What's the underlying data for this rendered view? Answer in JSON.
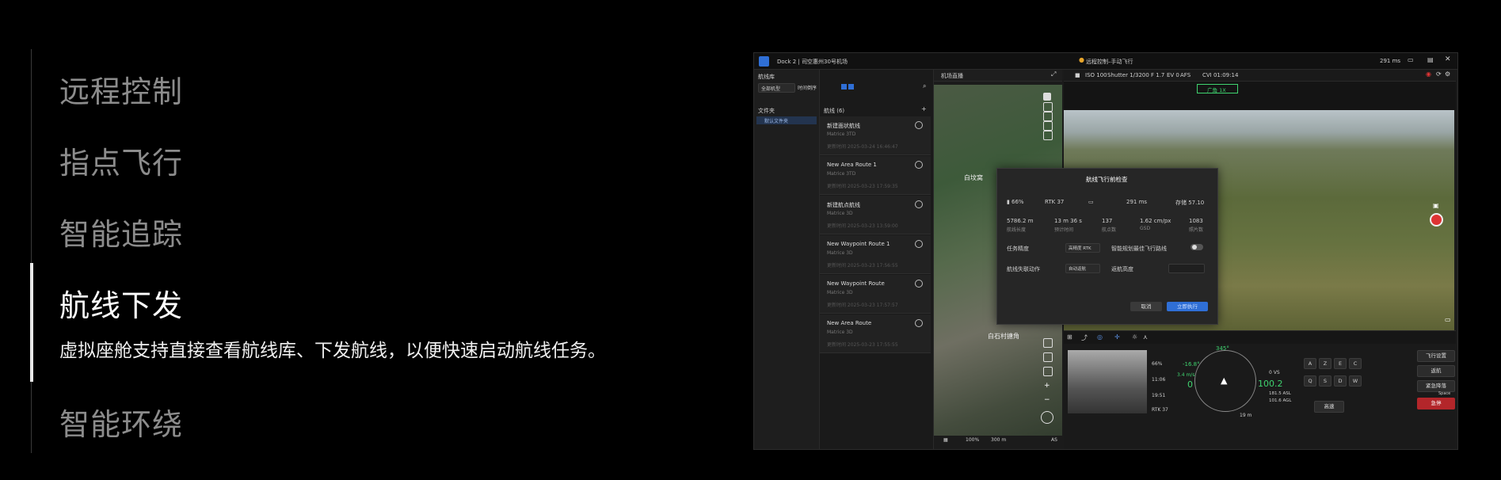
{
  "features": [
    {
      "label": "远程控制"
    },
    {
      "label": "指点飞行"
    },
    {
      "label": "智能追踪"
    },
    {
      "label": "航线下发",
      "active": true
    },
    {
      "label": "智能环绕"
    }
  ],
  "feature_desc": "虚拟座舱支持直接查看航线库、下发航线，以便快速启动航线任务。",
  "app": {
    "title": "Dock 2 | 司空惠州30号机场",
    "status": "远程控制–手动飞行",
    "latency": "291 ms"
  },
  "library": {
    "header": "航线库",
    "filter_model": "全部机型",
    "filter_sort": "时间倒序",
    "folders_header": "文件夹",
    "folder_default": "默认文件夹",
    "routes_header": "航线 (6)",
    "routes": [
      {
        "name": "新建面状航线",
        "model": "Matrice 3TD",
        "date": "更新时间 2025-03-24 16:46:47"
      },
      {
        "name": "New Area Route 1",
        "model": "Matrice 3TD",
        "date": "更新时间 2025-03-23 17:59:35"
      },
      {
        "name": "新建航点航线",
        "model": "Matrice 3D",
        "date": "更新时间 2025-03-23 13:59:00"
      },
      {
        "name": "New Waypoint Route 1",
        "model": "Matrice 3D",
        "date": "更新时间 2025-03-23 17:56:55"
      },
      {
        "name": "New Waypoint Route",
        "model": "Matrice 3D",
        "date": "更新时间 2025-03-23 17:57:57"
      },
      {
        "name": "New Area Route",
        "model": "Matrice 3D",
        "date": "更新时间 2025-03-23 17:55:55"
      }
    ]
  },
  "map": {
    "header": "机场直播",
    "label1": "白坟窝",
    "label2": "白石村搪角",
    "zoom": "100%",
    "scale": "300 m",
    "corner": "AS"
  },
  "camera": {
    "iso": "ISO 100",
    "shutter": "Shutter 1/3200",
    "fnum": "F 1.7",
    "ev": "EV 0",
    "af": "AFS",
    "rec": "CVI 01:09:14",
    "mode": "广角 1X"
  },
  "dialog": {
    "title": "航线飞行前检查",
    "battery": "66%",
    "rtk": "RTK 37",
    "latency": "291 ms",
    "storage": "存储 57.10",
    "stats": [
      {
        "value": "5786.2 m",
        "label": "航线长度"
      },
      {
        "value": "13 m 36 s",
        "label": "预计时间"
      },
      {
        "value": "137",
        "label": "航点数"
      },
      {
        "value": "1.62 cm/px",
        "label": "GSD"
      },
      {
        "value": "1083",
        "label": "照片数"
      }
    ],
    "precision_label": "任务精度",
    "precision_value": "高精度 RTK",
    "optimal_label": "智能规划最佳飞行路线",
    "lost_label": "航线失联动作",
    "lost_value": "自动返航",
    "rth_label": "返航高度",
    "cancel": "取消",
    "confirm": "立即执行"
  },
  "telemetry": {
    "battery": "66%",
    "time1": "11:06",
    "time2": "19:51",
    "rtk": "RTK 37",
    "heading": "345°",
    "pitch": "-16.8°",
    "hspeed": "3.4 m/s",
    "spd": "0",
    "vs": "0 VS",
    "alt": "100.2",
    "asl": "181.5 ASL",
    "agl": "101.6 AGL",
    "dist": "19 m"
  },
  "keys": [
    "A",
    "Z",
    "E",
    "C",
    "Q",
    "S",
    "D",
    "W"
  ],
  "key_low": "高速",
  "actions": {
    "flight_settings": "飞行设置",
    "rth": "返航",
    "emergency": "紧急降落",
    "pause": "急停",
    "pause_key": "Space"
  },
  "colors": {
    "accent": "#2f6fd6",
    "danger": "#b3262a",
    "active_text": "#ffffff",
    "inactive_text": "#8c8c8c"
  }
}
